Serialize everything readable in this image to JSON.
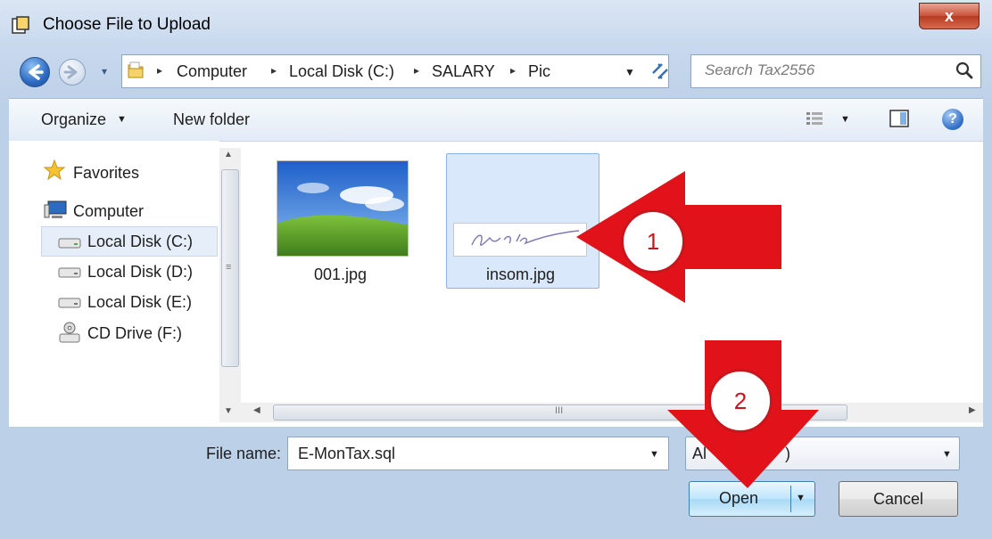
{
  "window": {
    "title": "Choose File to Upload",
    "close_glyph": "x"
  },
  "address": {
    "crumbs": [
      "Computer",
      "Local Disk (C:)",
      "SALARY",
      "Pic"
    ],
    "separator": "▸",
    "dropdown": "▾"
  },
  "search": {
    "placeholder": "Search Tax2556"
  },
  "toolbar": {
    "organize_label": "Organize",
    "organize_arrow": "▼",
    "new_folder_label": "New folder",
    "view_arrow": "▼",
    "help_glyph": "?"
  },
  "nav": {
    "items": [
      {
        "label": "Favorites",
        "icon": "star-icon"
      },
      {
        "label": "Computer",
        "icon": "computer-icon"
      },
      {
        "label": "Local Disk (C:)",
        "icon": "drive-icon",
        "selected": true
      },
      {
        "label": "Local Disk (D:)",
        "icon": "drive-icon"
      },
      {
        "label": "Local Disk (E:)",
        "icon": "drive-icon"
      },
      {
        "label": "CD Drive (F:)",
        "icon": "cd-drive-icon"
      }
    ]
  },
  "files": [
    {
      "name": "001.jpg",
      "selected": false
    },
    {
      "name": "insom.jpg",
      "selected": true
    }
  ],
  "scroll": {
    "up": "▲",
    "down": "▼",
    "left": "◀",
    "right": "▶",
    "grip_v": "≡",
    "grip_h": "III"
  },
  "bottom": {
    "filename_label": "File name:",
    "filename_value": "E-MonTax.sql",
    "filter_visible": "Al",
    "filter_tail": ")",
    "open_label": "Open",
    "cancel_label": "Cancel",
    "dd": "▼"
  },
  "annotations": {
    "step1": "1",
    "step2": "2",
    "color": "#e2121a"
  },
  "colors": {
    "selection": "#d9e8fa",
    "accent": "#2d6ac2"
  }
}
